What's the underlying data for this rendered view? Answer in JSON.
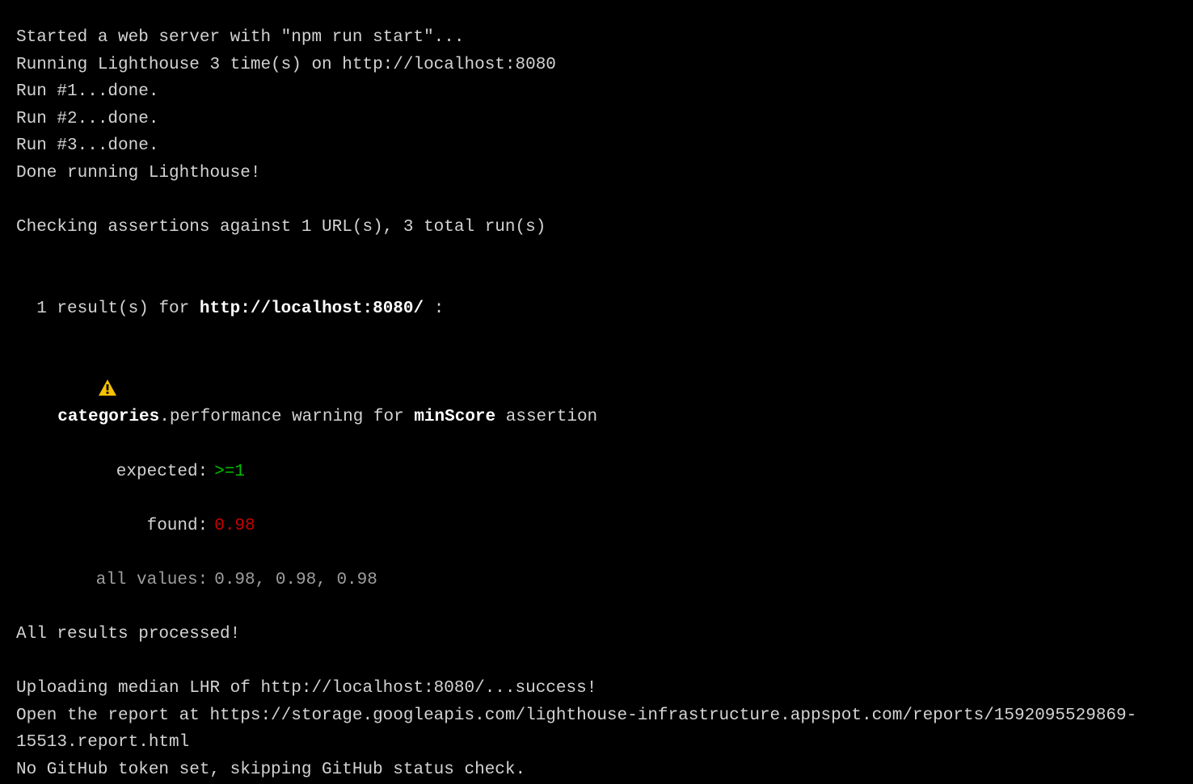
{
  "lines": {
    "started": "Started a web server with \"npm run start\"...",
    "running": "Running Lighthouse 3 time(s) on http://localhost:8080",
    "run1": "Run #1...done.",
    "run2": "Run #2...done.",
    "run3": "Run #3...done.",
    "done_lh": "Done running Lighthouse!",
    "checking": "Checking assertions against 1 URL(s), 3 total run(s)",
    "results_prefix": "1 result(s) for ",
    "results_url": "http://localhost:8080/",
    "results_suffix": " :",
    "assert": {
      "cat_bold": "categories",
      "after_cat": ".performance warning for ",
      "minscore": "minScore",
      "after_min": " assertion",
      "expected_label": "expected:",
      "expected_val": ">=1",
      "found_label": "found:",
      "found_val": "0.98",
      "allvals_label": "all values:",
      "allvals_val": "0.98, 0.98, 0.98"
    },
    "processed": "All results processed!",
    "upload": "Uploading median LHR of http://localhost:8080/...success!",
    "open_report": "Open the report at https://storage.googleapis.com/lighthouse-infrastructure.appspot.com/reports/1592095529869-15513.report.html",
    "no_token": "No GitHub token set, skipping GitHub status check."
  }
}
